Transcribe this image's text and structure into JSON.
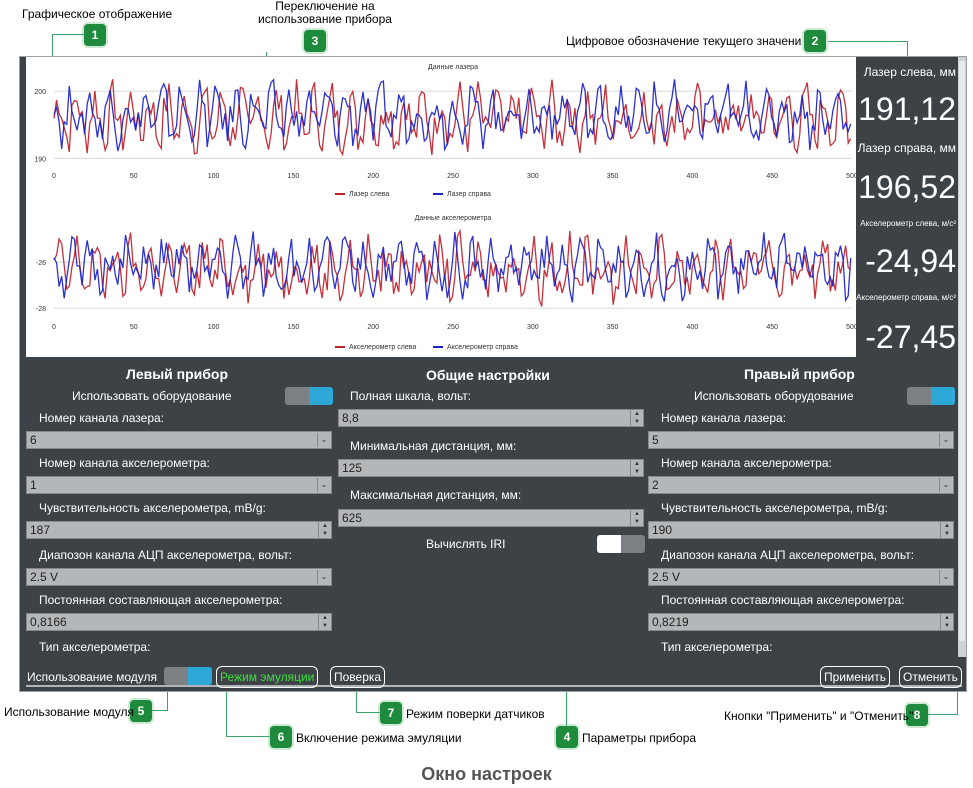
{
  "callouts": [
    {
      "num": "1",
      "text": "Графическое отображение"
    },
    {
      "num": "2",
      "text": "Цифровое обозначение текущего значения"
    },
    {
      "num": "3",
      "text": "Переключение на\nиспользование прибора"
    },
    {
      "num": "4",
      "text": "Параметры прибора"
    },
    {
      "num": "5",
      "text": "Использование модуля"
    },
    {
      "num": "6",
      "text": "Включение режима эмуляции"
    },
    {
      "num": "7",
      "text": "Режим поверки датчиков"
    },
    {
      "num": "8",
      "text": "Кнопки \"Применить\" и \"Отменить\""
    }
  ],
  "colors": {
    "accent_green": "#1e8a3c",
    "series_left": "#c0202a",
    "series_right": "#1a22c8",
    "toggle_on": "#2ea8d6",
    "window_bg": "#3d4247"
  },
  "chart_data": [
    {
      "type": "line",
      "title": "Данные лазера",
      "x_ticks": [
        "0",
        "50",
        "100",
        "150",
        "200",
        "250",
        "300",
        "350",
        "400",
        "450",
        "500"
      ],
      "y_ticks": [
        "190",
        "200"
      ],
      "xlim": [
        0,
        500
      ],
      "ylim": [
        189,
        203
      ],
      "series": [
        {
          "name": "Лазер слева",
          "color": "#c0202a",
          "range": [
            190,
            202
          ]
        },
        {
          "name": "Лазер справа",
          "color": "#1a22c8",
          "range": [
            191,
            202
          ]
        }
      ]
    },
    {
      "type": "line",
      "title": "Данные акселерометра",
      "x_ticks": [
        "0",
        "50",
        "100",
        "150",
        "200",
        "250",
        "300",
        "350",
        "400",
        "450",
        "500"
      ],
      "y_ticks": [
        "-26",
        "-28"
      ],
      "xlim": [
        0,
        500
      ],
      "ylim": [
        -28.3,
        -24.3
      ],
      "series": [
        {
          "name": "Акселерометр слева",
          "color": "#c0202a",
          "range": [
            -28,
            -24.6
          ]
        },
        {
          "name": "Акселерометр справа",
          "color": "#1a22c8",
          "range": [
            -27.8,
            -24.6
          ]
        }
      ]
    }
  ],
  "readouts": [
    {
      "label": "Лазер слева, мм",
      "value": "191,12"
    },
    {
      "label": "Лазер справа, мм",
      "value": "196,52"
    },
    {
      "label": "Акселерометр слева, м/с²",
      "value": "-24,94"
    },
    {
      "label": "Акселерометр справа, м/с²",
      "value": "-27,45"
    }
  ],
  "left_device": {
    "title": "Левый прибор",
    "use_equipment": "Использовать оборудование",
    "laser_channel_label": "Номер канала лазера:",
    "laser_channel": "6",
    "accel_channel_label": "Номер канала акселерометра:",
    "accel_channel": "1",
    "sensitivity_label": "Чувствительность акселерометра, mB/g:",
    "sensitivity": "187",
    "adc_range_label": "Диапозон канала АЦП акселерометра, вольт:",
    "adc_range": "2.5 V",
    "dc_label": "Постоянная составляющая акселерометра:",
    "dc": "0,8166",
    "type_label": "Тип акселерометра:"
  },
  "common": {
    "title": "Общие настройки",
    "full_scale_label": "Полная шкала, вольт:",
    "full_scale": "8,8",
    "min_dist_label": "Минимальная дистанция, мм:",
    "min_dist": "125",
    "max_dist_label": "Максимальная дистанция, мм:",
    "max_dist": "625",
    "iri_label": "Вычислять IRI"
  },
  "right_device": {
    "title": "Правый прибор",
    "use_equipment": "Использовать оборудование",
    "laser_channel_label": "Номер канала лазера:",
    "laser_channel": "5",
    "accel_channel_label": "Номер канала акселерометра:",
    "accel_channel": "2",
    "sensitivity_label": "Чувствительность акселерометра, mB/g:",
    "sensitivity": "190",
    "adc_range_label": "Диапозон канала АЦП акселерометра, вольт:",
    "adc_range": "2.5 V",
    "dc_label": "Постоянная составляющая акселерометра:",
    "dc": "0,8219",
    "type_label": "Тип акселерометра:"
  },
  "bottom": {
    "module_use": "Использование модуля",
    "emulation": "Режим эмуляции",
    "verify": "Поверка",
    "apply": "Применить",
    "cancel": "Отменить"
  },
  "footer": "Окно настроек"
}
